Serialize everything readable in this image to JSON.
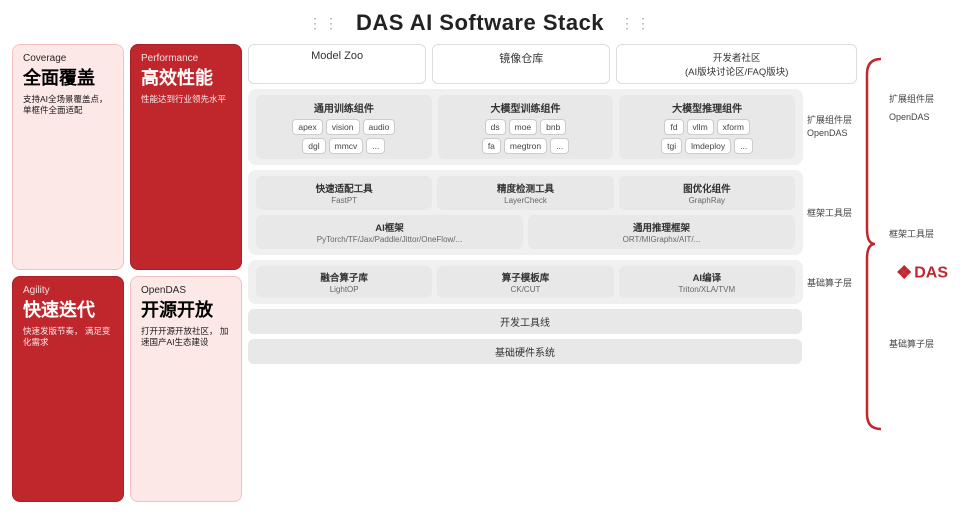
{
  "header": {
    "title": "DAS AI Software Stack",
    "dots_left": "⋮⋮",
    "dots_right": "⋮⋮"
  },
  "left_panels": {
    "top_left": {
      "label": "Coverage",
      "title_zh": "全面覆盖",
      "desc": "支持AI全场景覆盖点，\n单框件全面适配"
    },
    "top_right": {
      "label": "Performance",
      "title_zh": "高效性能",
      "desc": "性能达到行业领先水平"
    },
    "bottom_left": {
      "label": "Agility",
      "title_zh": "快速迭代",
      "desc": "快速发版节奏，\n满足变化需求"
    },
    "bottom_right": {
      "label": "OpenDAS",
      "title_zh": "开源开放",
      "desc": "打开开源开放社区，\n加速国产AI生态建设"
    }
  },
  "top_bar": {
    "items": [
      {
        "text": "Model Zoo"
      },
      {
        "text": "镜像仓库"
      },
      {
        "text": "开发者社区\n(AI版块讨论区/FAQ版块)"
      }
    ]
  },
  "training_section": {
    "groups": [
      {
        "title": "通用训练组件",
        "row1": [
          "apex",
          "vision",
          "audio"
        ],
        "row2": [
          "dgl",
          "mmcv",
          "..."
        ]
      },
      {
        "title": "大模型训练组件",
        "row1": [
          "ds",
          "moe",
          "bnb"
        ],
        "row2": [
          "fa",
          "megtron",
          "..."
        ]
      },
      {
        "title": "大模型推理组件",
        "row1": [
          "fd",
          "vllm",
          "xform"
        ],
        "row2": [
          "tgi",
          "lmdeploy",
          "..."
        ]
      }
    ],
    "layer_label": "扩展组件层\nOpenDAS"
  },
  "framework_section": {
    "tools": [
      {
        "title": "快速适配工具",
        "sub": "FastPT"
      },
      {
        "title": "精度检测工具",
        "sub": "LayerCheck"
      },
      {
        "title": "图优化组件",
        "sub": "GraphRay"
      }
    ],
    "wide_items": [
      {
        "title": "AI框架",
        "sub": "PyTorch/TF/Jax/Paddle/Jittor/OneFlow/..."
      },
      {
        "title": "通用推理框架",
        "sub": "ORT/MIGraphx/AIT/..."
      }
    ],
    "layer_label": "框架工具层"
  },
  "ops_section": {
    "tools": [
      {
        "title": "融合算子库",
        "sub": "LightOP"
      },
      {
        "title": "算子模板库",
        "sub": "CK/CUT"
      },
      {
        "title": "AI编译",
        "sub": "Triton/XLA/TVM"
      }
    ],
    "layer_label": "基础算子层"
  },
  "bottom_bars": {
    "dev_tools": "开发工具线",
    "hardware": "基础硬件系统"
  },
  "das_logo": {
    "icon": "❖",
    "text": "DAS"
  }
}
